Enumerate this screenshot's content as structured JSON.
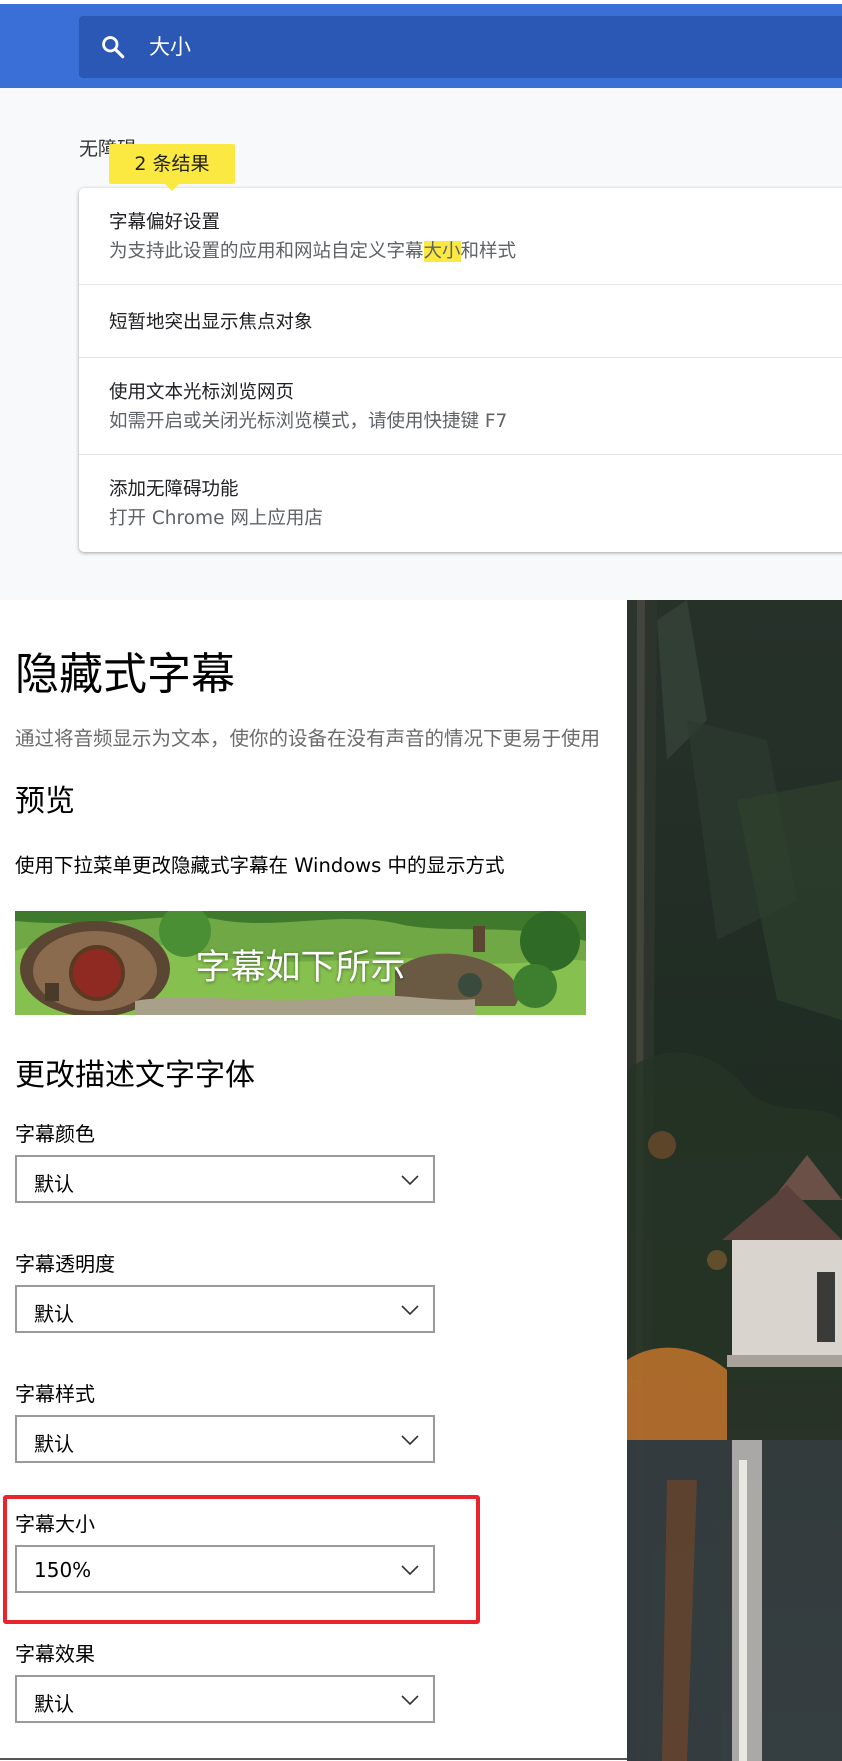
{
  "search": {
    "icon": "search-icon",
    "value": "大小"
  },
  "settings": {
    "section_title": "无障碍",
    "results_badge": "2 条结果",
    "results": [
      {
        "title": "字幕偏好设置",
        "desc_before": "为支持此设置的应用和网站自定义字幕",
        "desc_highlight": "大小",
        "desc_after": "和样式"
      },
      {
        "title": "短暂地突出显示焦点对象"
      },
      {
        "title": "使用文本光标浏览网页",
        "desc": "如需开启或关闭光标浏览模式，请使用快捷键 F7"
      },
      {
        "title": "添加无障碍功能",
        "desc": "打开 Chrome 网上应用店"
      }
    ],
    "highlight_color": "#fbe840"
  },
  "captions": {
    "title": "隐藏式字幕",
    "intro": "通过将音频显示为文本，使你的设备在没有声音的情况下更易于使用",
    "preview_heading": "预览",
    "preview_instruction": "使用下拉菜单更改隐藏式字幕在 Windows 中的显示方式",
    "preview_caption": "字幕如下所示",
    "font_heading": "更改描述文字字体",
    "fields": [
      {
        "label": "字幕颜色",
        "value": "默认"
      },
      {
        "label": "字幕透明度",
        "value": "默认"
      },
      {
        "label": "字幕样式",
        "value": "默认"
      },
      {
        "label": "字幕大小",
        "value": "150%"
      },
      {
        "label": "字幕效果",
        "value": "默认"
      }
    ],
    "annotation_color": "#e8242d"
  },
  "colors": {
    "chrome_header": "#3b6fd8",
    "search_box": "#2b57b5"
  }
}
